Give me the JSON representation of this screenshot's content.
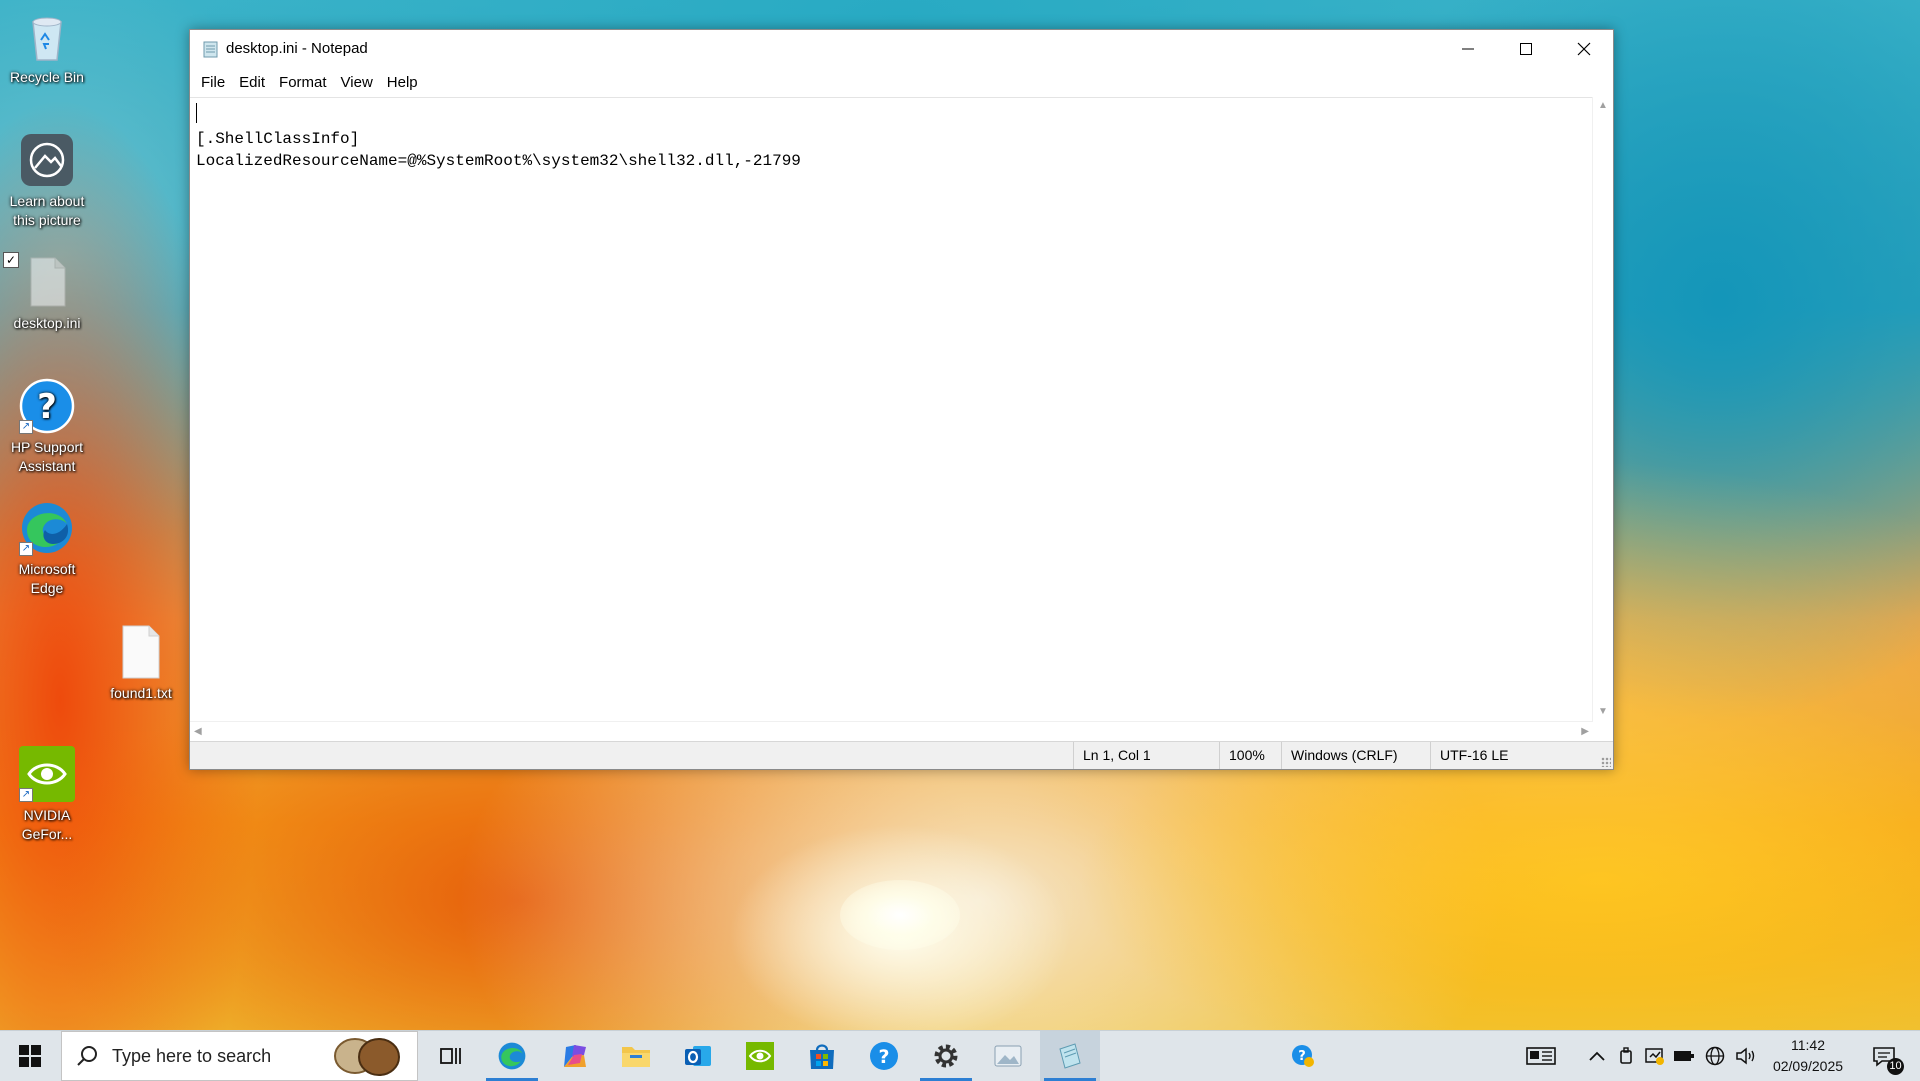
{
  "desktop": {
    "icons": [
      {
        "label": "Recycle Bin"
      },
      {
        "label": "Learn about this picture"
      },
      {
        "label": "desktop.ini"
      },
      {
        "label": "HP Support Assistant"
      },
      {
        "label": "Microsoft Edge"
      },
      {
        "label": "found1.txt"
      },
      {
        "label": "NVIDIA GeFor..."
      }
    ]
  },
  "window": {
    "title": "desktop.ini - Notepad",
    "menu": [
      "File",
      "Edit",
      "Format",
      "View",
      "Help"
    ],
    "content": "\n[.ShellClassInfo]\nLocalizedResourceName=@%SystemRoot%\\system32\\shell32.dll,-21799",
    "status": {
      "position": "Ln 1, Col 1",
      "zoom": "100%",
      "line_ending": "Windows (CRLF)",
      "encoding": "UTF-16 LE"
    }
  },
  "taskbar": {
    "search_placeholder": "Type here to search",
    "apps": [
      "task-view",
      "microsoft-edge",
      "copilot",
      "file-explorer",
      "outlook",
      "nvidia",
      "microsoft-store",
      "help",
      "settings",
      "photos",
      "notepad"
    ],
    "clock": {
      "time": "11:42",
      "date": "02/09/2025"
    },
    "notification_count": "10"
  },
  "colors": {
    "accent": "#2d7fd3",
    "taskbar_bg": "#dfe5ea",
    "nvidia_green": "#76b900",
    "edge_blue": "#1c8ad6"
  }
}
